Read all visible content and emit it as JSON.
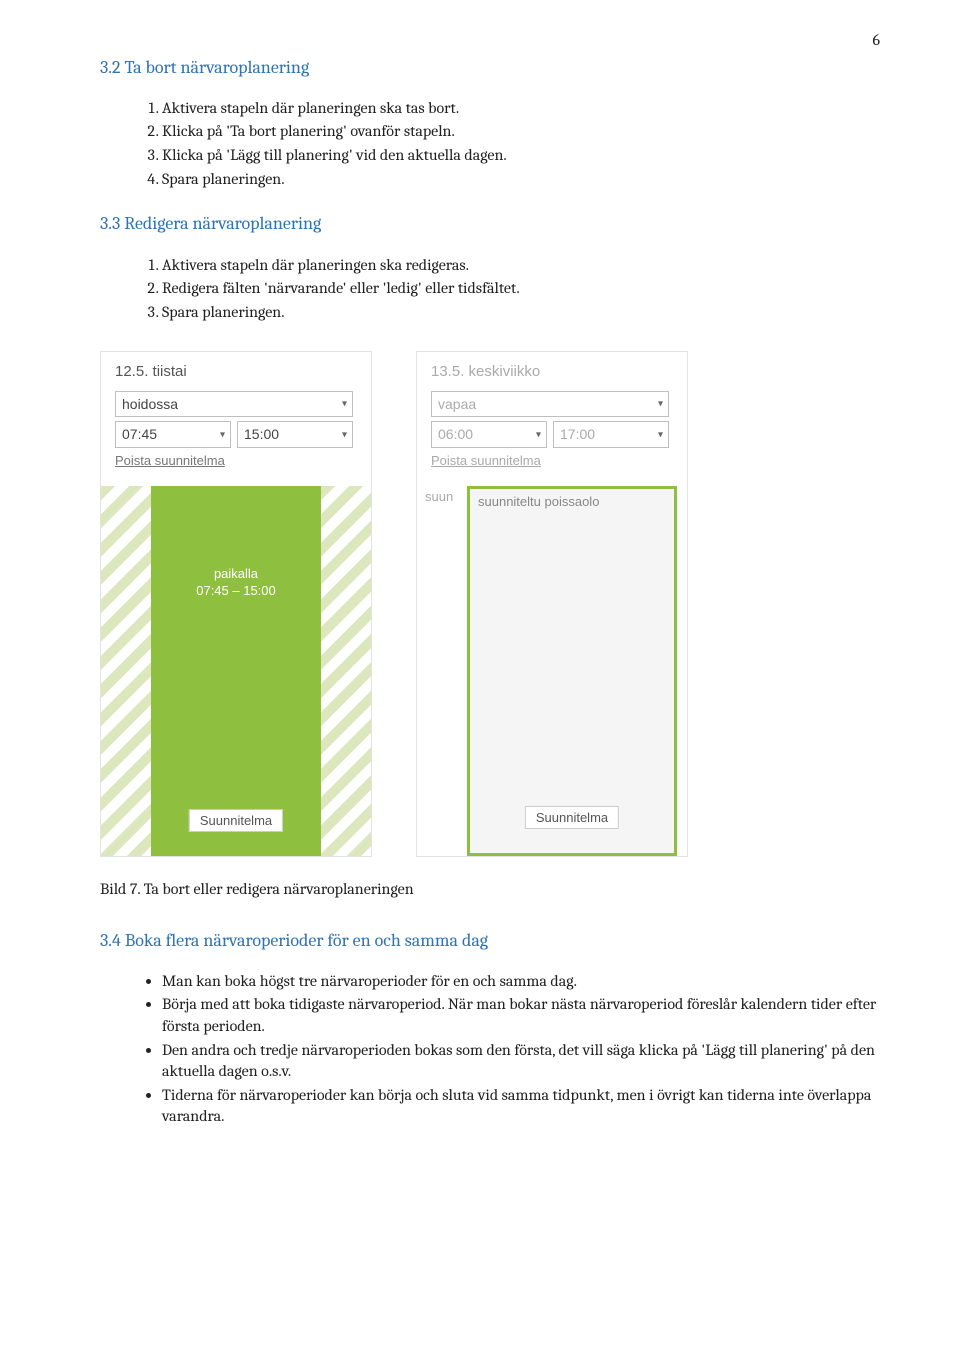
{
  "page_number": "6",
  "section32": {
    "heading": "3.2   Ta bort närvaroplanering",
    "items": [
      "Aktivera stapeln där planeringen ska tas bort.",
      "Klicka på 'Ta bort planering' ovanför stapeln.",
      "Klicka på 'Lägg till planering' vid den aktuella dagen.",
      "Spara planeringen."
    ]
  },
  "section33": {
    "heading": "3.3   Redigera närvaroplanering",
    "items": [
      "Aktivera stapeln där planeringen ska redigeras.",
      "Redigera fälten 'närvarande' eller 'ledig' eller tidsfältet.",
      "Spara planeringen."
    ]
  },
  "card_left": {
    "date": "12.5. tiistai",
    "status_select": "hoidossa",
    "time_start": "07:45",
    "time_end": "15:00",
    "remove": "Poista suunnitelma",
    "block_status": "paikalla",
    "block_time": "07:45 – 15:00",
    "plan_button": "Suunnitelma"
  },
  "card_right": {
    "date": "13.5. keskiviikko",
    "status_select": "vapaa",
    "time_start": "06:00",
    "time_end": "17:00",
    "remove": "Poista suunnitelma",
    "left_label": "suun",
    "block_title": "suunniteltu poissaolo",
    "plan_button": "Suunnitelma"
  },
  "caption": "Bild 7. Ta bort eller redigera närvaroplaneringen",
  "section34": {
    "heading": "3.4   Boka flera närvaroperioder för en och samma dag",
    "bullets": [
      "Man kan boka högst tre närvaroperioder för en och samma dag.",
      "Börja med att boka tidigaste närvaroperiod. När man bokar nästa närvaroperiod föreslår kalendern tider efter första perioden.",
      "Den andra och tredje närvaroperioden bokas som den första, det vill säga klicka på 'Lägg till planering' på den aktuella dagen o.s.v.",
      "Tiderna för närvaroperioder kan börja och sluta vid samma tidpunkt, men i övrigt kan tiderna inte överlappa varandra."
    ]
  }
}
